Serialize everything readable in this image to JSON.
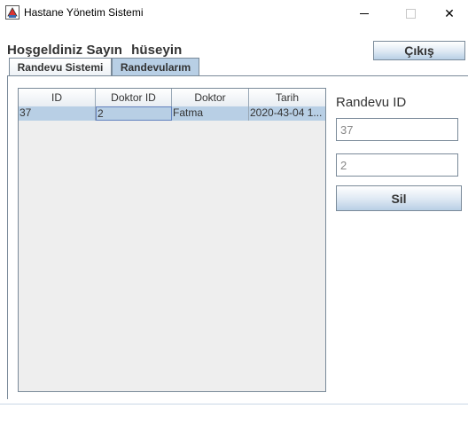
{
  "window": {
    "title": "Hastane Yönetim Sistemi",
    "app_icon": "java-cup-icon",
    "controls": {
      "minimize_icon": "minimize-icon",
      "maximize_icon": "maximize-icon",
      "close_glyph": "✕"
    }
  },
  "header": {
    "greeting": "Hoşgeldiniz Sayın",
    "user_name": "hüseyin",
    "logout_label": "Çıkış"
  },
  "tabs": [
    {
      "label": "Randevu Sistemi",
      "active": false
    },
    {
      "label": "Randevularım",
      "active": true
    }
  ],
  "table": {
    "columns": [
      "ID",
      "Doktor ID",
      "Doktor",
      "Tarih"
    ],
    "rows": [
      {
        "id": "37",
        "doctor_id": "2",
        "doctor": "Fatma",
        "date": "2020-43-04 1..."
      }
    ]
  },
  "form": {
    "label": "Randevu ID",
    "appointment_id": "37",
    "doctor_id": "2",
    "delete_label": "Sil"
  },
  "colors": {
    "accent": "#b8cfe5",
    "border": "#7a8a99",
    "text": "#333333"
  }
}
